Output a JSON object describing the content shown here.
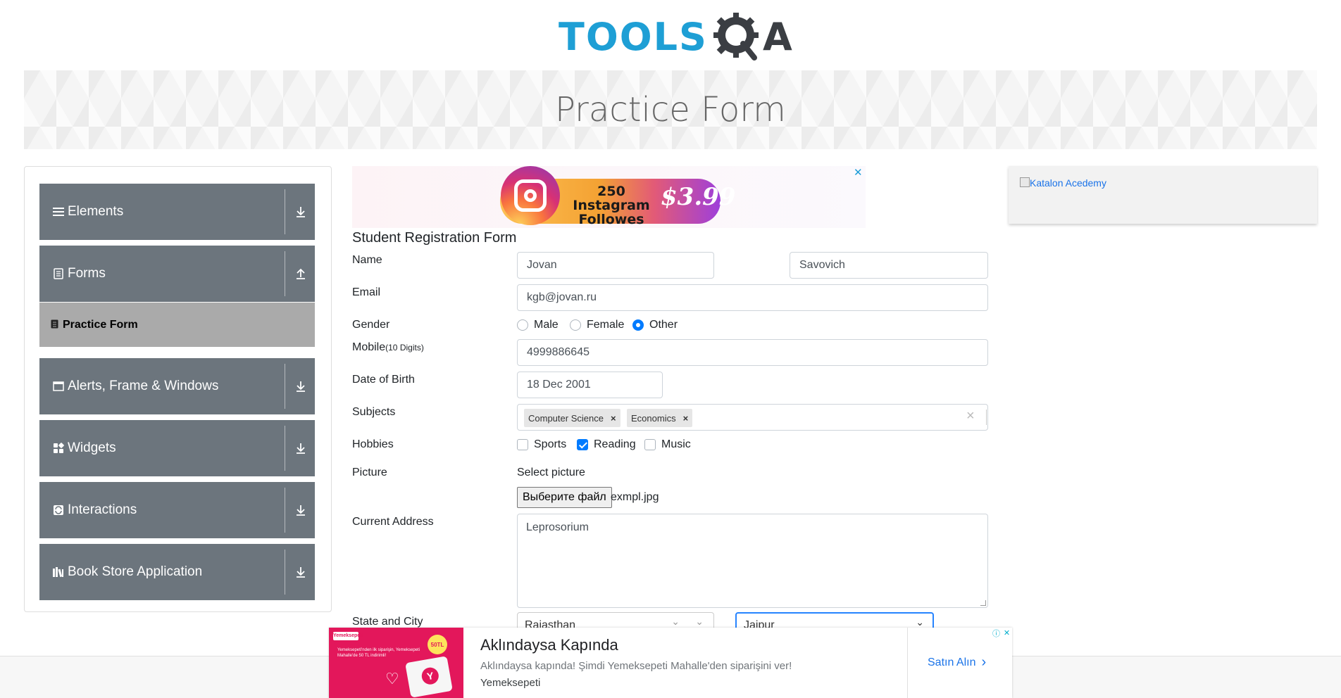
{
  "logo": {
    "brand_left": "TOOLS",
    "brand_right": "A"
  },
  "banner": {
    "title": "Practice Form"
  },
  "sidebar": {
    "groups": [
      {
        "label": "Elements",
        "icon": "menu-icon",
        "arrow": "down"
      },
      {
        "label": "Forms",
        "icon": "form-icon",
        "arrow": "up"
      },
      {
        "label": "Alerts, Frame & Windows",
        "icon": "window-icon",
        "arrow": "down"
      },
      {
        "label": "Widgets",
        "icon": "widgets-icon",
        "arrow": "down"
      },
      {
        "label": "Interactions",
        "icon": "interactions-icon",
        "arrow": "down"
      },
      {
        "label": "Book Store Application",
        "icon": "books-icon",
        "arrow": "down"
      }
    ],
    "active_item": "Practice Form"
  },
  "ad_top": {
    "line1": "250 Instagram",
    "line2": "Followes",
    "price": "$3.99",
    "close": "✕"
  },
  "ad_right": {
    "alt_text": "Katalon Acedemy"
  },
  "form": {
    "title": "Student Registration Form",
    "name_label": "Name",
    "first_name": "Jovan",
    "last_name": "Savovich",
    "email_label": "Email",
    "email": "kgb@jovan.ru",
    "gender_label": "Gender",
    "gender_options": [
      "Male",
      "Female",
      "Other"
    ],
    "gender_selected": "Other",
    "mobile_label": "Mobile",
    "mobile_hint": "(10 Digits)",
    "mobile": "4999886645",
    "dob_label": "Date of Birth",
    "dob": "18 Dec 2001",
    "subjects_label": "Subjects",
    "subjects": [
      "Computer Science",
      "Economics"
    ],
    "subjects_clear": "×",
    "hobbies_label": "Hobbies",
    "hobbies": [
      {
        "label": "Sports",
        "checked": false
      },
      {
        "label": "Reading",
        "checked": true
      },
      {
        "label": "Music",
        "checked": false
      }
    ],
    "picture_label": "Picture",
    "select_picture": "Select picture",
    "file_button": "Выберите файл",
    "file_name": "exmpl.jpg",
    "address_label": "Current Address",
    "address": "Leprosorium",
    "state_city_label": "State and City",
    "state": "Rajasthan",
    "city": "Jaipur"
  },
  "ad_bottom": {
    "title": "Aklındaysa Kapında",
    "description": "Aklındaysa kapında! Şimdi Yemeksepeti Mahalle'den siparişini ver!",
    "brand": "Yemeksepeti",
    "cta": "Satın Alın",
    "img_logo": "Yemeksepeti",
    "img_badge": "50TL",
    "img_text": "Yemeksepeti'nden ilk siparişin, Yemeksepeti Mahalle'de 50 TL indirimli!"
  },
  "colors": {
    "sidebar_bg": "#6c757d",
    "active_item_bg": "#aaaaaa",
    "accent": "#007bff",
    "logo_blue": "#1e9fd5",
    "logo_dark": "#3b3e43"
  }
}
